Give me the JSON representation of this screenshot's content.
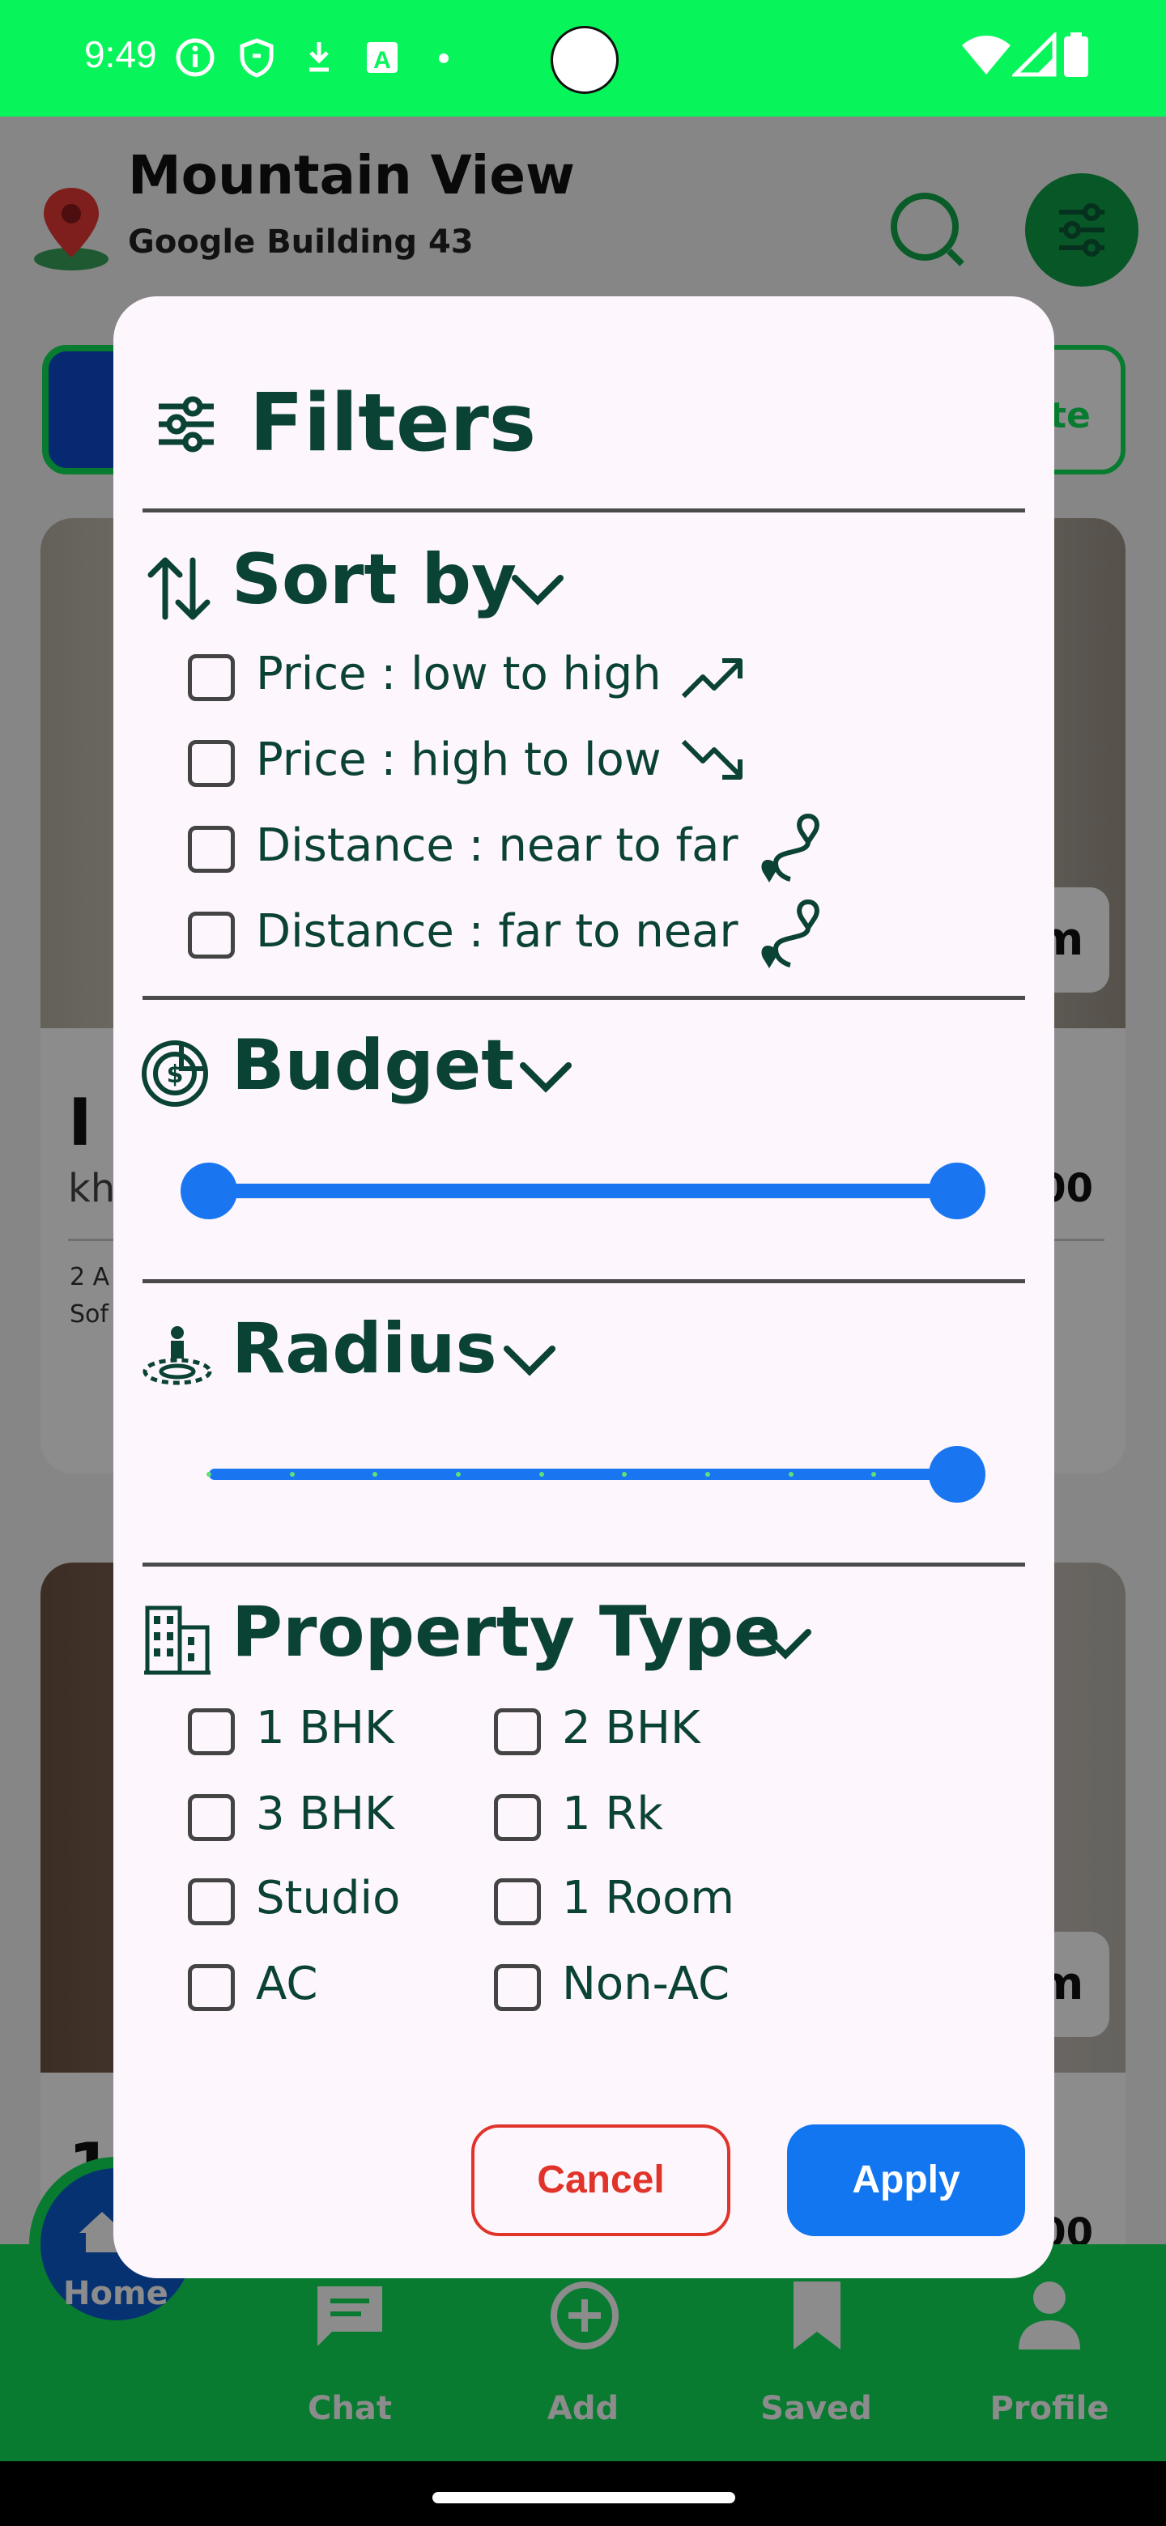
{
  "status_bar": {
    "time": "9:49"
  },
  "header": {
    "title": "Mountain View",
    "subtitle": "Google Building 43"
  },
  "background": {
    "chip_right_text": "te",
    "card1": {
      "title_fragment": "I I",
      "location_fragment": "kh",
      "price_fragment": "00",
      "meta_line1": "2 A",
      "meta_line2": "Sof",
      "badge_text": "m"
    },
    "card2": {
      "title_fragment": "1",
      "price_fragment": "00",
      "badge_text": "m"
    }
  },
  "bottom_nav": {
    "items": [
      {
        "label": "Home",
        "icon": "home-icon"
      },
      {
        "label": "Chat",
        "icon": "chat-icon"
      },
      {
        "label": "Add",
        "icon": "add-icon"
      },
      {
        "label": "Saved",
        "icon": "bookmark-icon"
      },
      {
        "label": "Profile",
        "icon": "profile-icon"
      }
    ]
  },
  "dialog": {
    "title": "Filters",
    "sort": {
      "title": "Sort by",
      "options": [
        {
          "label": "Price : low to high",
          "icon": "trending-up-icon",
          "checked": false
        },
        {
          "label": "Price : high to low",
          "icon": "trending-down-icon",
          "checked": false
        },
        {
          "label": "Distance : near to far",
          "icon": "route-icon",
          "checked": false
        },
        {
          "label": "Distance : far to near",
          "icon": "route-icon",
          "checked": false
        }
      ]
    },
    "budget": {
      "title": "Budget",
      "range_start_fraction": 0.0,
      "range_end_fraction": 1.0
    },
    "radius": {
      "title": "Radius",
      "value_fraction": 1.0,
      "divisions": 9
    },
    "property_type": {
      "title": "Property Type",
      "options": [
        {
          "label": "1 BHK",
          "checked": false
        },
        {
          "label": "2 BHK",
          "checked": false
        },
        {
          "label": "3 BHK",
          "checked": false
        },
        {
          "label": "1 Rk",
          "checked": false
        },
        {
          "label": "Studio",
          "checked": false
        },
        {
          "label": "1 Room",
          "checked": false
        },
        {
          "label": "AC",
          "checked": false
        },
        {
          "label": "Non-AC",
          "checked": false
        }
      ]
    },
    "buttons": {
      "cancel": "Cancel",
      "apply": "Apply"
    }
  },
  "colors": {
    "status_green": "#07f55a",
    "primary_dark_green": "#0b4236",
    "slider_blue": "#1976f0",
    "cancel_red": "#e0342a",
    "dialog_bg": "#fdf6fc"
  }
}
